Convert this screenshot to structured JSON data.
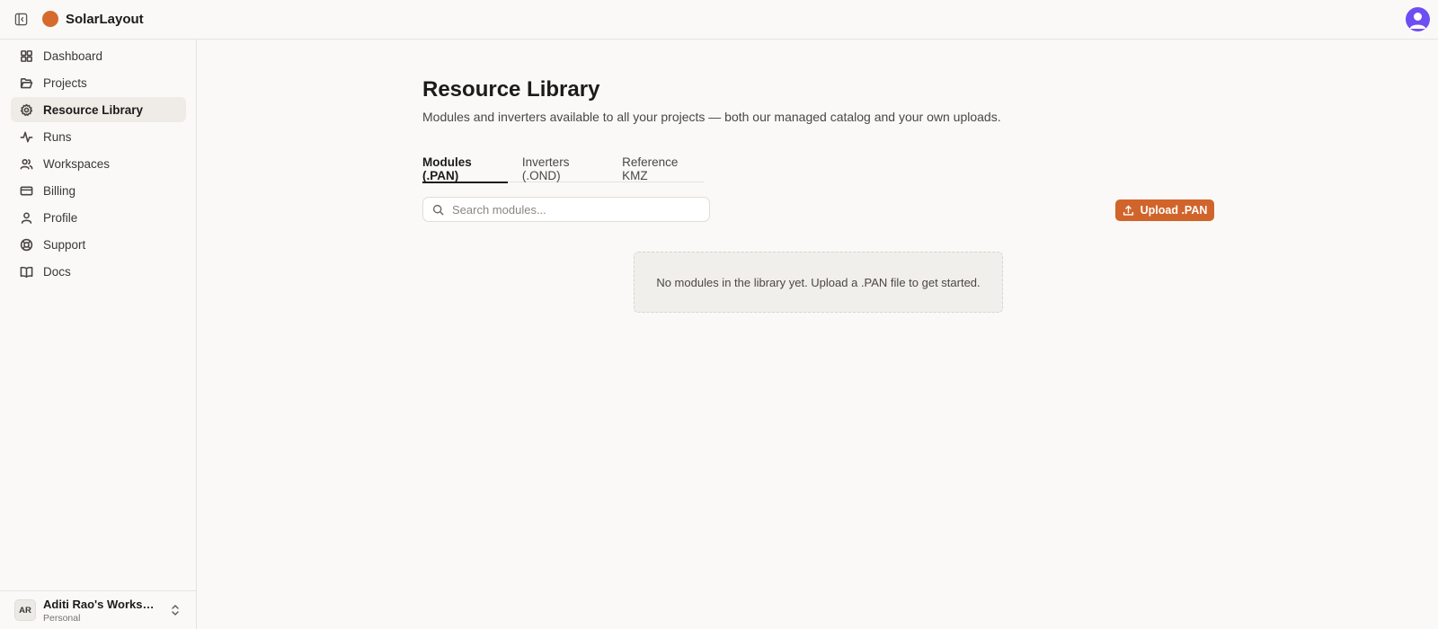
{
  "app": {
    "name": "SolarLayout",
    "brand_color": "#d66a2c"
  },
  "sidebar": {
    "items": [
      {
        "label": "Dashboard",
        "icon": "dashboard-icon",
        "active": false
      },
      {
        "label": "Projects",
        "icon": "folder-icon",
        "active": false
      },
      {
        "label": "Resource Library",
        "icon": "gear-icon",
        "active": true
      },
      {
        "label": "Runs",
        "icon": "activity-icon",
        "active": false
      },
      {
        "label": "Workspaces",
        "icon": "users-icon",
        "active": false
      },
      {
        "label": "Billing",
        "icon": "credit-card-icon",
        "active": false
      },
      {
        "label": "Profile",
        "icon": "user-icon",
        "active": false
      },
      {
        "label": "Support",
        "icon": "lifebuoy-icon",
        "active": false
      },
      {
        "label": "Docs",
        "icon": "book-icon",
        "active": false
      }
    ],
    "workspace": {
      "initials": "AR",
      "name": "Aditi Rao's Workspace",
      "type": "Personal"
    }
  },
  "main": {
    "title": "Resource Library",
    "description": "Modules and inverters available to all your projects — both our managed catalog and your own uploads.",
    "tabs": [
      {
        "label": "Modules (.PAN)",
        "active": true
      },
      {
        "label": "Inverters (.OND)",
        "active": false
      },
      {
        "label": "Reference KMZ",
        "active": false
      }
    ],
    "search": {
      "placeholder": "Search modules...",
      "value": ""
    },
    "upload_label": "Upload .PAN",
    "empty_message": "No modules in the library yet. Upload a .PAN file to get started."
  },
  "colors": {
    "accent": "#d1642a",
    "avatar": "#6d4ef2"
  }
}
